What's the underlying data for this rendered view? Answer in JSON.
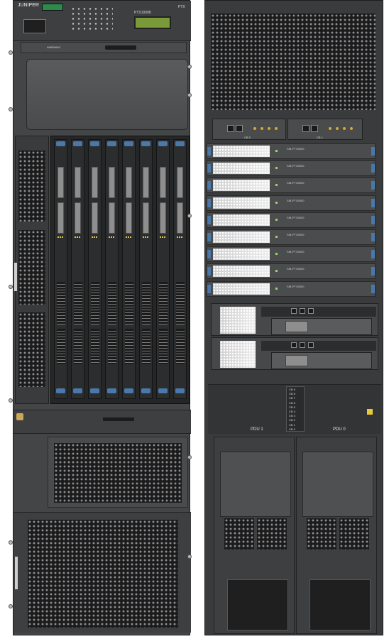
{
  "left_chassis": {
    "brand": "JUNIPER",
    "model": "PTX10008",
    "status_text": "PTX",
    "warning_text": "WARNING",
    "fpc_slots": 8
  },
  "right_chassis": {
    "cb_labels": [
      "CB 0",
      "CB 1"
    ],
    "module_label": "SIB-PTX5000",
    "module_count": 9,
    "pdu_labels": [
      "PDU 1",
      "PDU 0"
    ],
    "breaker_labels": [
      "CB 9",
      "CB 8",
      "CB 7",
      "CB 6",
      "CB 5",
      "CB 4",
      "CB 3",
      "CB 2",
      "CB 1",
      "CB 0"
    ],
    "rcb_label": "RE-PTX"
  },
  "colors": {
    "chassis": "#3b3c3e",
    "accent_blue": "#4a78a8",
    "lcd_green": "#7a9a3a"
  }
}
